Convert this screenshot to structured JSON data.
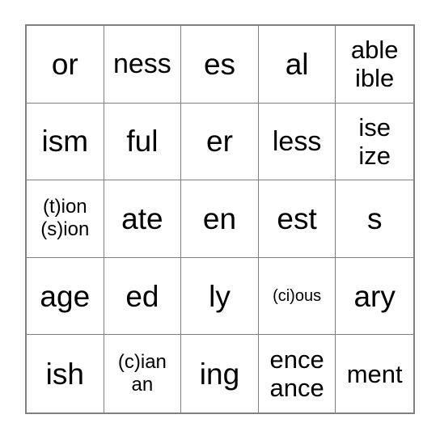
{
  "card": {
    "kind": "bingo-card",
    "rows": 5,
    "columns": 5,
    "colors": {
      "background": "#ffffff",
      "grid_line": "#808080",
      "border": "#808080",
      "text": "#000000"
    },
    "cells": [
      [
        {
          "lines": [
            "or"
          ],
          "size": "xl"
        },
        {
          "lines": [
            "ness"
          ],
          "size": "lg"
        },
        {
          "lines": [
            "es"
          ],
          "size": "xl"
        },
        {
          "lines": [
            "al"
          ],
          "size": "xl"
        },
        {
          "lines": [
            "able",
            "ible"
          ],
          "size": "md"
        }
      ],
      [
        {
          "lines": [
            "ism"
          ],
          "size": "xl"
        },
        {
          "lines": [
            "ful"
          ],
          "size": "xl"
        },
        {
          "lines": [
            "er"
          ],
          "size": "xl"
        },
        {
          "lines": [
            "less"
          ],
          "size": "lg"
        },
        {
          "lines": [
            "ise",
            "ize"
          ],
          "size": "md"
        }
      ],
      [
        {
          "lines": [
            "(t)ion",
            "(s)ion"
          ],
          "size": "sm"
        },
        {
          "lines": [
            "ate"
          ],
          "size": "xl"
        },
        {
          "lines": [
            "en"
          ],
          "size": "xl"
        },
        {
          "lines": [
            "est"
          ],
          "size": "xl"
        },
        {
          "lines": [
            "s"
          ],
          "size": "xl"
        }
      ],
      [
        {
          "lines": [
            "age"
          ],
          "size": "xl"
        },
        {
          "lines": [
            "ed"
          ],
          "size": "xl"
        },
        {
          "lines": [
            "ly"
          ],
          "size": "xl"
        },
        {
          "lines": [
            "(ci)ous"
          ],
          "size": "xs"
        },
        {
          "lines": [
            "ary"
          ],
          "size": "xl"
        }
      ],
      [
        {
          "lines": [
            "ish"
          ],
          "size": "xl"
        },
        {
          "lines": [
            "(c)ian",
            "an"
          ],
          "size": "sm"
        },
        {
          "lines": [
            "ing"
          ],
          "size": "xl"
        },
        {
          "lines": [
            "ence",
            "ance"
          ],
          "size": "md"
        },
        {
          "lines": [
            "ment"
          ],
          "size": "md"
        }
      ]
    ]
  }
}
